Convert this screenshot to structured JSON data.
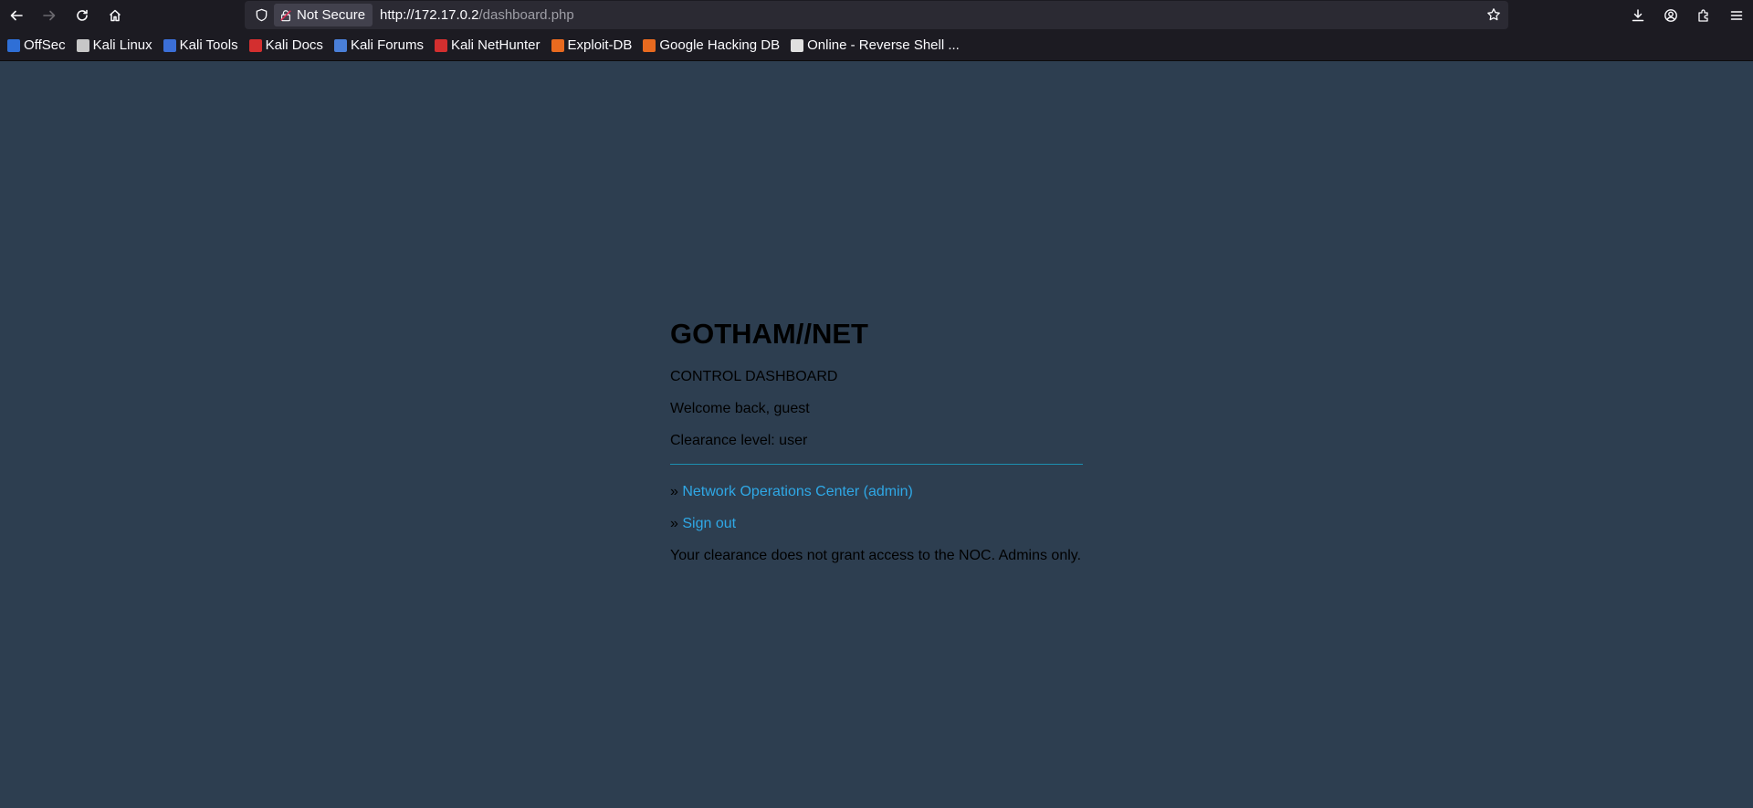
{
  "browser": {
    "security_label": "Not Secure",
    "url_host": "http://172.17.0.2",
    "url_path": "/dashboard.php"
  },
  "bookmarks": [
    {
      "label": "OffSec",
      "color": "#2f6fd6"
    },
    {
      "label": "Kali Linux",
      "color": "#c7c7c7"
    },
    {
      "label": "Kali Tools",
      "color": "#3b6fd8"
    },
    {
      "label": "Kali Docs",
      "color": "#d32f2f"
    },
    {
      "label": "Kali Forums",
      "color": "#4a7fd8"
    },
    {
      "label": "Kali NetHunter",
      "color": "#d32f2f"
    },
    {
      "label": "Exploit-DB",
      "color": "#e86a1f"
    },
    {
      "label": "Google Hacking DB",
      "color": "#e86a1f"
    },
    {
      "label": "Online - Reverse Shell ...",
      "color": "#e0e0e0"
    }
  ],
  "dashboard": {
    "title": "GOTHAM//NET",
    "subtitle": "CONTROL DASHBOARD",
    "welcome": "Welcome back, guest",
    "clearance": "Clearance level: user",
    "link_prefix": "» ",
    "noc_link": "Network Operations Center (admin)",
    "signout_link": "Sign out",
    "message": "Your clearance does not grant access to the NOC. Admins only."
  }
}
